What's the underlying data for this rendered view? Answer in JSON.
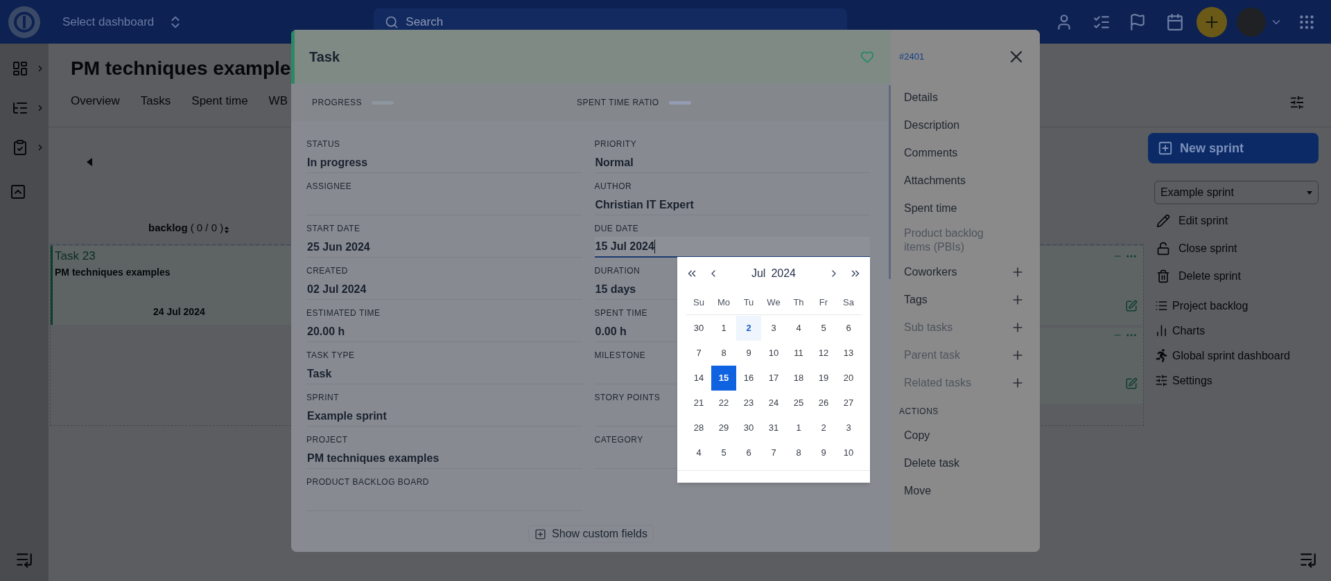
{
  "top_bar": {
    "dashboard_select": "Select dashboard",
    "search": {
      "placeholder": "Search"
    }
  },
  "page": {
    "title": "PM techniques example",
    "tabs": [
      "Overview",
      "Tasks",
      "Spent time",
      "WB"
    ]
  },
  "board": {
    "column": {
      "name": "backlog",
      "count": "( 0 / 0 )"
    },
    "cards": [
      {
        "id": "Task 23",
        "project": "PM techniques examples",
        "date": "24 Jul 2024"
      }
    ]
  },
  "sprint_panel": {
    "new_button": "New sprint",
    "sprint_select": "Example sprint",
    "actions": [
      "Edit sprint",
      "Close sprint",
      "Delete sprint"
    ],
    "links": [
      "Project backlog",
      "Charts",
      "Global sprint dashboard",
      "Settings"
    ]
  },
  "modal": {
    "title": "Task",
    "favorite": false,
    "id": "#2401",
    "progress": [
      {
        "label": "PROGRESS",
        "level": 0
      },
      {
        "label": "SPENT TIME RATIO",
        "level": 0
      }
    ],
    "fields": [
      {
        "label": "STATUS",
        "value": "In progress",
        "focused": false
      },
      {
        "label": "PRIORITY",
        "value": "Normal",
        "focused": false
      },
      {
        "label": "ASSIGNEE",
        "focused": false
      },
      {
        "label": "AUTHOR",
        "value": "Christian IT Expert",
        "focused": false
      },
      {
        "label": "START DATE",
        "value": "25 Jun 2024",
        "focused": false
      },
      {
        "label": "DUE DATE",
        "value": "15 Jul 2024",
        "focused": true
      },
      {
        "label": "CREATED",
        "value": "02 Jul 2024",
        "focused": false
      },
      {
        "label": "DURATION",
        "value": "15 days",
        "focused": false
      },
      {
        "label": "ESTIMATED TIME",
        "value": "20.00 h",
        "focused": false
      },
      {
        "label": "SPENT TIME",
        "value": "0.00 h",
        "focused": false
      },
      {
        "label": "TASK TYPE",
        "value": "Task",
        "focused": false
      },
      {
        "label": "MILESTONE",
        "focused": false
      },
      {
        "label": "SPRINT",
        "value": "Example sprint",
        "focused": false
      },
      {
        "label": "STORY POINTS",
        "focused": false
      },
      {
        "label": "PROJECT",
        "value": "PM techniques examples",
        "focused": false
      },
      {
        "label": "CATEGORY",
        "focused": false
      },
      {
        "label": "PRODUCT BACKLOG BOARD",
        "focused": false
      }
    ],
    "show_custom_fields": "Show custom fields",
    "menu": [
      {
        "label": "Details",
        "disabled": false,
        "addable": false
      },
      {
        "label": "Description",
        "disabled": false,
        "addable": false
      },
      {
        "label": "Comments",
        "disabled": false,
        "addable": false
      },
      {
        "label": "Attachments",
        "disabled": false,
        "addable": false
      },
      {
        "label": "Spent time",
        "disabled": false,
        "addable": false
      },
      {
        "label": "Product backlog items (PBIs)",
        "disabled": true,
        "addable": false
      },
      {
        "label": "Coworkers",
        "disabled": false,
        "addable": true
      },
      {
        "label": "Tags",
        "disabled": false,
        "addable": true
      },
      {
        "label": "Sub tasks",
        "disabled": true,
        "addable": true
      },
      {
        "label": "Parent task",
        "disabled": true,
        "addable": true
      },
      {
        "label": "Related tasks",
        "disabled": true,
        "addable": true
      }
    ],
    "actions_heading": "ACTIONS",
    "actions": [
      "Copy",
      "Delete task",
      "Move"
    ]
  },
  "calendar": {
    "month": "Jul",
    "year": "2024",
    "weekdays": [
      "Su",
      "Mo",
      "Tu",
      "We",
      "Th",
      "Fr",
      "Sa"
    ],
    "weeks": [
      [
        {
          "day": "30",
          "today": false,
          "selected": false
        },
        {
          "day": "1",
          "today": false,
          "selected": false
        },
        {
          "day": "2",
          "today": true,
          "selected": false
        },
        {
          "day": "3",
          "today": false,
          "selected": false
        },
        {
          "day": "4",
          "today": false,
          "selected": false
        },
        {
          "day": "5",
          "today": false,
          "selected": false
        },
        {
          "day": "6",
          "today": false,
          "selected": false
        }
      ],
      [
        {
          "day": "7",
          "today": false,
          "selected": false
        },
        {
          "day": "8",
          "today": false,
          "selected": false
        },
        {
          "day": "9",
          "today": false,
          "selected": false
        },
        {
          "day": "10",
          "today": false,
          "selected": false
        },
        {
          "day": "11",
          "today": false,
          "selected": false
        },
        {
          "day": "12",
          "today": false,
          "selected": false
        },
        {
          "day": "13",
          "today": false,
          "selected": false
        }
      ],
      [
        {
          "day": "14",
          "today": false,
          "selected": false
        },
        {
          "day": "15",
          "today": false,
          "selected": true
        },
        {
          "day": "16",
          "today": false,
          "selected": false
        },
        {
          "day": "17",
          "today": false,
          "selected": false
        },
        {
          "day": "18",
          "today": false,
          "selected": false
        },
        {
          "day": "19",
          "today": false,
          "selected": false
        },
        {
          "day": "20",
          "today": false,
          "selected": false
        }
      ],
      [
        {
          "day": "21",
          "today": false,
          "selected": false
        },
        {
          "day": "22",
          "today": false,
          "selected": false
        },
        {
          "day": "23",
          "today": false,
          "selected": false
        },
        {
          "day": "24",
          "today": false,
          "selected": false
        },
        {
          "day": "25",
          "today": false,
          "selected": false
        },
        {
          "day": "26",
          "today": false,
          "selected": false
        },
        {
          "day": "27",
          "today": false,
          "selected": false
        }
      ],
      [
        {
          "day": "28",
          "today": false,
          "selected": false
        },
        {
          "day": "29",
          "today": false,
          "selected": false
        },
        {
          "day": "30",
          "today": false,
          "selected": false
        },
        {
          "day": "31",
          "today": false,
          "selected": false
        },
        {
          "day": "1",
          "today": false,
          "selected": false
        },
        {
          "day": "2",
          "today": false,
          "selected": false
        },
        {
          "day": "3",
          "today": false,
          "selected": false
        }
      ],
      [
        {
          "day": "4",
          "today": false,
          "selected": false
        },
        {
          "day": "5",
          "today": false,
          "selected": false
        },
        {
          "day": "6",
          "today": false,
          "selected": false
        },
        {
          "day": "7",
          "today": false,
          "selected": false
        },
        {
          "day": "8",
          "today": false,
          "selected": false
        },
        {
          "day": "9",
          "today": false,
          "selected": false
        },
        {
          "day": "10",
          "today": false,
          "selected": false
        }
      ]
    ]
  }
}
